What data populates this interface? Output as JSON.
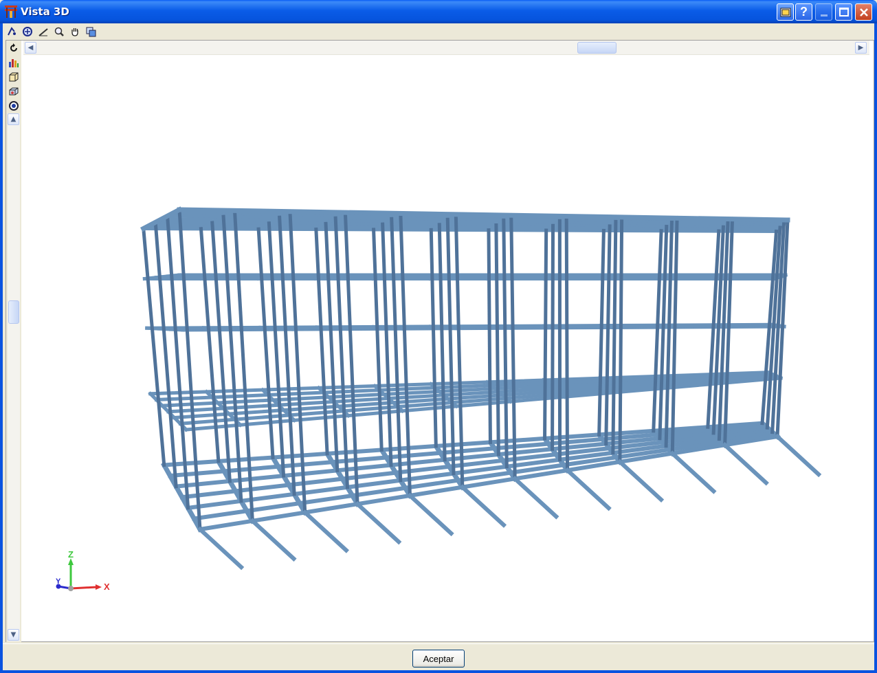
{
  "window": {
    "title": "Vista 3D"
  },
  "toolbar": {
    "tools": [
      "rotate-icon",
      "zoom-window-icon",
      "measure-icon",
      "zoom-icon",
      "pan-icon",
      "copy-view-icon"
    ]
  },
  "side_toolbar": {
    "tools": [
      "refresh-icon",
      "chart-icon",
      "box-view-icon",
      "cube-view-icon",
      "visibility-icon"
    ]
  },
  "axes": {
    "z": "Z",
    "y": "Y",
    "x": "X",
    "colors": {
      "z": "#3ec83e",
      "y": "#2a2acc",
      "x": "#e03030"
    }
  },
  "model": {
    "color": "#6a93bb",
    "dark": "#4f7299",
    "light": "#8db3d6"
  },
  "footer": {
    "accept_label": "Aceptar"
  }
}
